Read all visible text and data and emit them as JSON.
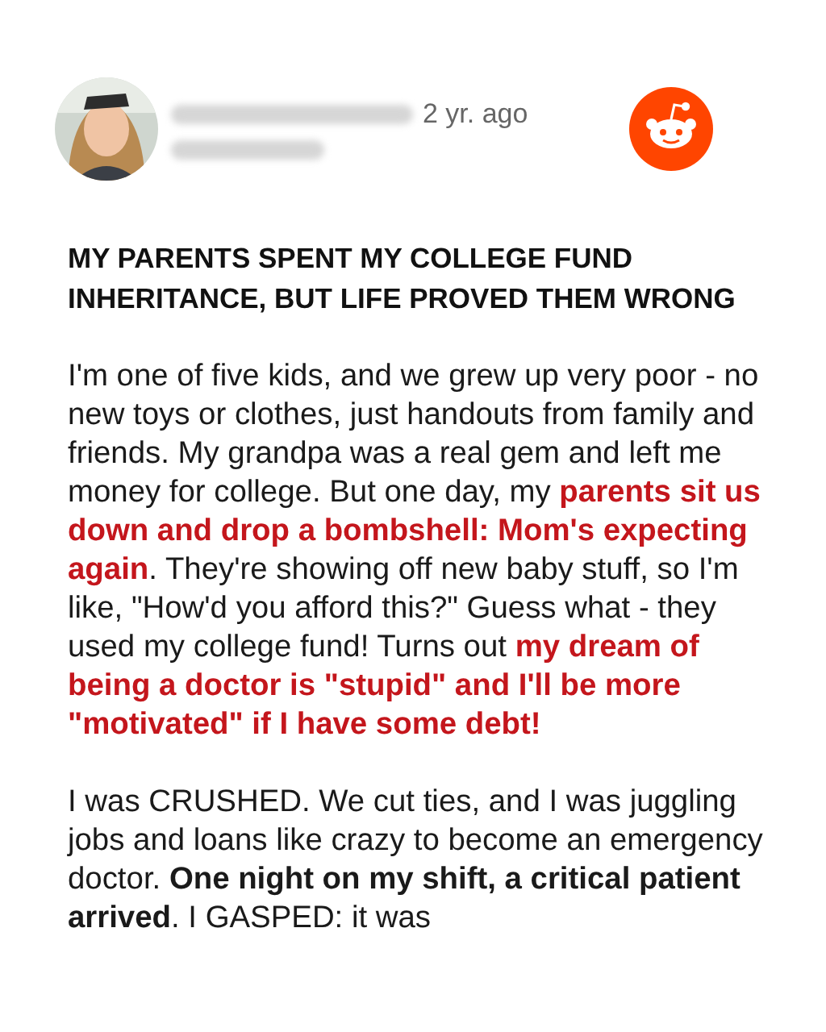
{
  "post": {
    "time": "2 yr. ago",
    "title": "MY PARENTS SPENT MY COLLEGE FUND INHERITANCE, BUT LIFE PROVED THEM WRONG",
    "paragraphs": [
      {
        "segments": [
          {
            "kind": "plain",
            "text": "I'm one of five kids, and we grew up very poor - no new toys or clothes, just handouts from family and friends. My grandpa was a real gem and left me money for college. But one day, my "
          },
          {
            "kind": "highlight",
            "text": "parents sit us down and drop a bombshell: Mom's expecting again"
          },
          {
            "kind": "plain",
            "text": ". They're showing off new baby stuff, so I'm like, \"How'd you afford this?\" Guess what - they used my college fund! Turns out "
          },
          {
            "kind": "highlight",
            "text": "my dream of being a doctor is \"stupid\" and I'll be more \"motivated\" if I have some debt!"
          }
        ]
      },
      {
        "segments": [
          {
            "kind": "plain",
            "text": "I was CRUSHED. We cut ties, and I was juggling jobs and loans like crazy to become an emergency doctor. "
          },
          {
            "kind": "bold",
            "text": "One night on my shift, a critical patient arrived"
          },
          {
            "kind": "plain",
            "text": ". I GASPED: it was"
          }
        ]
      }
    ]
  }
}
